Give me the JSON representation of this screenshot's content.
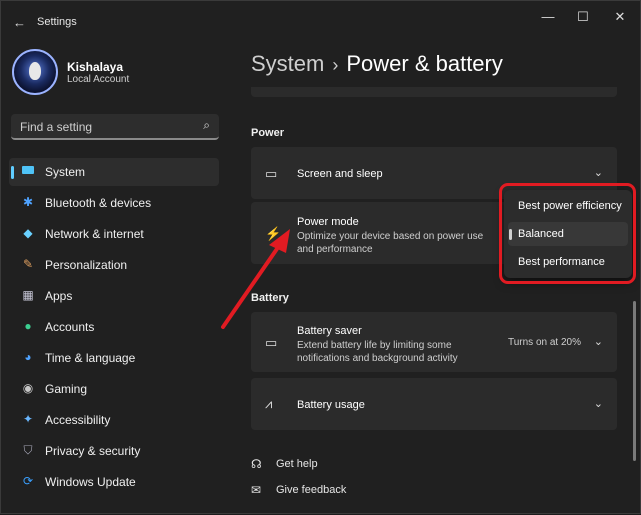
{
  "window": {
    "title": "Settings",
    "back_icon": "back-arrow-icon",
    "controls": [
      "—",
      "☐",
      "✕"
    ]
  },
  "profile": {
    "name": "Kishalaya",
    "role": "Local Account"
  },
  "search": {
    "placeholder": "Find a setting",
    "icon": "search-icon"
  },
  "sidebar": {
    "items": [
      {
        "label": "System",
        "icon": "system-icon",
        "color": "#4fc3f7",
        "active": true
      },
      {
        "label": "Bluetooth & devices",
        "icon": "bluetooth-icon",
        "color": "#4fa3ff"
      },
      {
        "label": "Network & internet",
        "icon": "wifi-icon",
        "color": "#6ad1ff"
      },
      {
        "label": "Personalization",
        "icon": "brush-icon",
        "color": "#e0a060"
      },
      {
        "label": "Apps",
        "icon": "apps-icon",
        "color": "#c8c8d8"
      },
      {
        "label": "Accounts",
        "icon": "accounts-icon",
        "color": "#3ccf91"
      },
      {
        "label": "Time & language",
        "icon": "globe-icon",
        "color": "#4fa3ff"
      },
      {
        "label": "Gaming",
        "icon": "gaming-icon",
        "color": "#c8c8c8"
      },
      {
        "label": "Accessibility",
        "icon": "accessibility-icon",
        "color": "#6ab7ff"
      },
      {
        "label": "Privacy & security",
        "icon": "shield-icon",
        "color": "#a8a8b8"
      },
      {
        "label": "Windows Update",
        "icon": "update-icon",
        "color": "#3aa0ff"
      }
    ]
  },
  "breadcrumb": {
    "parent": "System",
    "separator": "›",
    "current": "Power & battery"
  },
  "power": {
    "section_title": "Power",
    "screen_sleep": {
      "title": "Screen and sleep",
      "icon": "screen-sleep-icon"
    },
    "power_mode": {
      "title": "Power mode",
      "subtitle": "Optimize your device based on power use and performance",
      "icon": "power-mode-icon"
    }
  },
  "power_mode_dropdown": {
    "options": [
      "Best power efficiency",
      "Balanced",
      "Best performance"
    ],
    "selected": "Balanced"
  },
  "battery": {
    "section_title": "Battery",
    "saver": {
      "title": "Battery saver",
      "subtitle": "Extend battery life by limiting some notifications and background activity",
      "status": "Turns on at 20%",
      "icon": "battery-saver-icon"
    },
    "usage": {
      "title": "Battery usage",
      "icon": "battery-usage-icon"
    }
  },
  "links": {
    "help": "Get help",
    "feedback": "Give feedback"
  },
  "colors": {
    "accent": "#60cdff",
    "highlight": "#e11b22",
    "background": "#202020",
    "card": "#2b2b2b"
  }
}
